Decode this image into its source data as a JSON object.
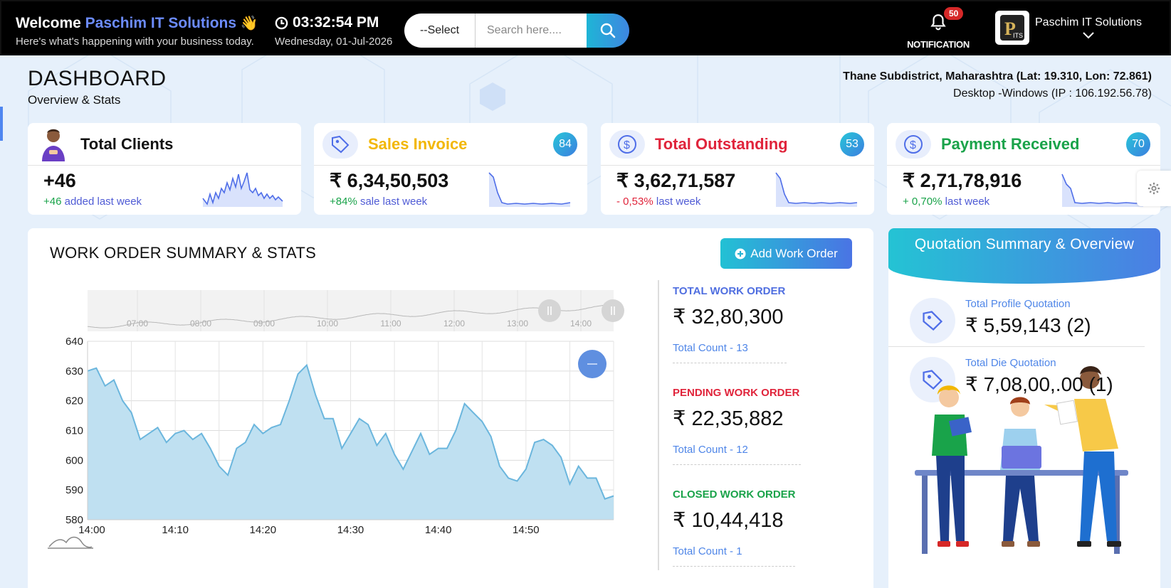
{
  "topbar": {
    "welcome_prefix": "Welcome",
    "company": "Paschim IT Solutions",
    "wave": "👋",
    "subtitle": "Here's what's happening with your business today.",
    "time": "03:32:54 PM",
    "date": "Wednesday, 01-Jul-2026",
    "select_label": "--Select",
    "search_placeholder": "Search here....",
    "notification_label": "NOTIFICATION",
    "notification_count": "50",
    "profile_name": "Paschim IT Solutions"
  },
  "header": {
    "title": "DASHBOARD",
    "subtitle": "Overview & Stats",
    "location": "Thane Subdistrict, Maharashtra (Lat: 19.310, Lon: 72.861)",
    "device": "Desktop -Windows (IP : 106.192.56.78)"
  },
  "cards": [
    {
      "title": "Total Clients",
      "color": "#111111",
      "badge": "",
      "value": "+46",
      "change": "+46",
      "change_text": "added last week",
      "change_color": "#1aa34a"
    },
    {
      "title": "Sales Invoice",
      "color": "#f2b705",
      "badge": "84",
      "value": "₹ 6,34,50,503",
      "change": "+84%",
      "change_text": "sale last week",
      "change_color": "#1aa34a"
    },
    {
      "title": "Total Outstanding",
      "color": "#e0243b",
      "badge": "53",
      "value": "₹ 3,62,71,587",
      "change": "- 0,53%",
      "change_text": "last week",
      "change_color": "#e0243b"
    },
    {
      "title": "Payment Received",
      "color": "#1aa34a",
      "badge": "70",
      "value": "₹ 2,71,78,916",
      "change": "+ 0,70%",
      "change_text": "last week",
      "change_color": "#1aa34a"
    }
  ],
  "work_orders": {
    "title": "WORK ORDER SUMMARY & STATS",
    "add_button": "Add Work Order",
    "stats": [
      {
        "label": "TOTAL WORK ORDER",
        "color": "#4f6ee0",
        "amount": "₹ 32,80,300",
        "count": "Total Count - 13"
      },
      {
        "label": "PENDING WORK ORDER",
        "color": "#e0243b",
        "amount": "₹ 22,35,882",
        "count": "Total Count - 12"
      },
      {
        "label": "CLOSED WORK ORDER",
        "color": "#1aa34a",
        "amount": "₹ 10,44,418",
        "count": "Total Count - 1"
      }
    ]
  },
  "quotation": {
    "title": "Quotation Summary & Overview",
    "rows": [
      {
        "label": "Total Profile Quotation",
        "amount": "₹ 5,59,143 (2)"
      },
      {
        "label": "Total Die Quotation",
        "amount": "₹ 7,08,00,.00 (1)"
      }
    ]
  },
  "chart_data": {
    "type": "area",
    "x": [
      "14:00",
      "14:01",
      "14:02",
      "14:03",
      "14:04",
      "14:05",
      "14:06",
      "14:07",
      "14:08",
      "14:09",
      "14:10",
      "14:11",
      "14:12",
      "14:13",
      "14:14",
      "14:15",
      "14:16",
      "14:17",
      "14:18",
      "14:19",
      "14:20",
      "14:21",
      "14:22",
      "14:23",
      "14:24",
      "14:25",
      "14:26",
      "14:27",
      "14:28",
      "14:29",
      "14:30",
      "14:31",
      "14:32",
      "14:33",
      "14:34",
      "14:35",
      "14:36",
      "14:37",
      "14:38",
      "14:39",
      "14:40",
      "14:41",
      "14:42",
      "14:43",
      "14:44",
      "14:45",
      "14:46",
      "14:47",
      "14:48",
      "14:49",
      "14:50",
      "14:51",
      "14:52",
      "14:53",
      "14:54",
      "14:55",
      "14:56",
      "14:57",
      "14:58",
      "14:59",
      "15:00"
    ],
    "values": [
      630,
      631,
      625,
      627,
      620,
      616,
      607,
      609,
      611,
      606,
      609,
      610,
      607,
      609,
      604,
      598,
      595,
      604,
      606,
      612,
      609,
      611,
      612,
      620,
      629,
      632,
      622,
      614,
      614,
      604,
      609,
      614,
      612,
      605,
      609,
      602,
      597,
      603,
      609,
      602,
      604,
      604,
      610,
      619,
      616,
      613,
      608,
      598,
      594,
      593,
      597,
      606,
      607,
      605,
      601,
      592,
      598,
      594,
      594,
      587,
      588
    ],
    "xticks": [
      "14:00",
      "14:10",
      "14:20",
      "14:30",
      "14:40",
      "14:50"
    ],
    "yticks": [
      580,
      590,
      600,
      610,
      620,
      630,
      640
    ],
    "ylim": [
      580,
      640
    ],
    "navigator_ticks": [
      "07:00",
      "08:00",
      "09:00",
      "10:00",
      "11:00",
      "12:00",
      "13:00",
      "14:00"
    ],
    "series_color": "#6bb6dd",
    "fill_color": "#bfe0f1",
    "grid": true
  }
}
